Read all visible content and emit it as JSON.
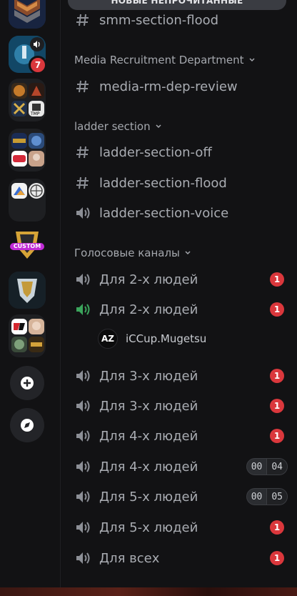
{
  "unread_banner": "НОВЫЕ НЕПРОЧИТАННЫЕ",
  "servers": [
    {
      "name": "server-chevron-rank",
      "icon": "chevron-rank-icon"
    },
    {
      "name": "server-volume",
      "icon": "speaker-icon",
      "badge": "7"
    },
    {
      "name": "server-folder-games",
      "icon": "folder-icon"
    },
    {
      "name": "server-folder-warcraft",
      "icon": "folder-icon"
    },
    {
      "name": "server-folder-map",
      "icon": "folder-icon"
    },
    {
      "name": "server-custom",
      "icon": "trophy-icon",
      "label": "CUSTOM"
    },
    {
      "name": "server-rank-emblem",
      "icon": "emblem-icon"
    },
    {
      "name": "server-folder-legends",
      "icon": "folder-icon"
    }
  ],
  "rail_buttons": {
    "add": "add-server-icon",
    "discover": "compass-icon"
  },
  "channels": {
    "top": {
      "label": "smm-section-flood",
      "icon": "hash-icon"
    },
    "cat_media": {
      "label": "Media Recruitment Department"
    },
    "media_review": {
      "label": "media-rm-dep-review",
      "icon": "hash-icon"
    },
    "cat_ladder": {
      "label": "ladder section"
    },
    "ladder_off": {
      "label": "ladder-section-off",
      "icon": "hash-icon"
    },
    "ladder_flood": {
      "label": "ladder-section-flood",
      "icon": "hash-icon"
    },
    "ladder_voice": {
      "label": "ladder-section-voice",
      "icon": "speaker-icon"
    },
    "cat_voice": {
      "label": "Голосовые каналы"
    },
    "voice": [
      {
        "label": "Для 2-х людей",
        "badge": "1",
        "active": false
      },
      {
        "label": "Для 2-х людей",
        "badge": "1",
        "active": true
      },
      {
        "label": "Для 3-х людей",
        "badge": "1"
      },
      {
        "label": "Для 3-х людей",
        "badge": "1"
      },
      {
        "label": "Для 4-х людей",
        "badge": "1"
      },
      {
        "label": "Для 4-х людей",
        "count_left": "00",
        "count_right": "04"
      },
      {
        "label": "Для 5-х людей",
        "count_left": "00",
        "count_right": "05"
      },
      {
        "label": "Для 5-х людей",
        "badge": "1"
      },
      {
        "label": "Для всех",
        "badge": "1"
      }
    ],
    "voice_user": {
      "avatar_text": "AZ",
      "name": "iCCup.Mugetsu"
    }
  },
  "colors": {
    "badge": "#da373c",
    "active_voice": "#3ba55c",
    "icon_grey": "#8c8f96"
  }
}
